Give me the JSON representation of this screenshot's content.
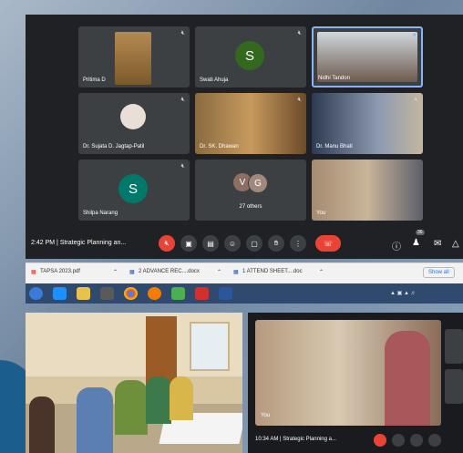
{
  "meet": {
    "participants": [
      {
        "name": "Pritima D"
      },
      {
        "name": "Swati Ahuja",
        "initial": "S",
        "color": "#33691e"
      },
      {
        "name": "Nidhi Tandon"
      },
      {
        "name": "Dr. Sujata D. Jagtap-Patil"
      },
      {
        "name": "Dr. SK. Dhawan"
      },
      {
        "name": "Dr. Manu Bhati"
      },
      {
        "name": "Shilpa Narang",
        "initial": "S",
        "color": "#00796b"
      },
      {
        "name": "27 others",
        "initials": [
          "V",
          "G"
        ]
      },
      {
        "name": "You"
      }
    ],
    "time": "2:42 PM",
    "separator": "|",
    "meeting_title": "Strategic Planning an...",
    "side_count": "36"
  },
  "downloads": [
    {
      "name": "TAPSA 2023.pdf"
    },
    {
      "name": "2 ADVANCE REC....docx"
    },
    {
      "name": "1 ATTEND SHEET....doc"
    }
  ],
  "downloads_show_all": "Show all",
  "call2": {
    "time": "10:34 AM",
    "separator": "|",
    "meeting_title": "Strategic Planning a...",
    "you_label": "You"
  },
  "colors": {
    "end_call": "#ea4335",
    "meet_bg": "#202124",
    "tile_bg": "#3c4043"
  }
}
